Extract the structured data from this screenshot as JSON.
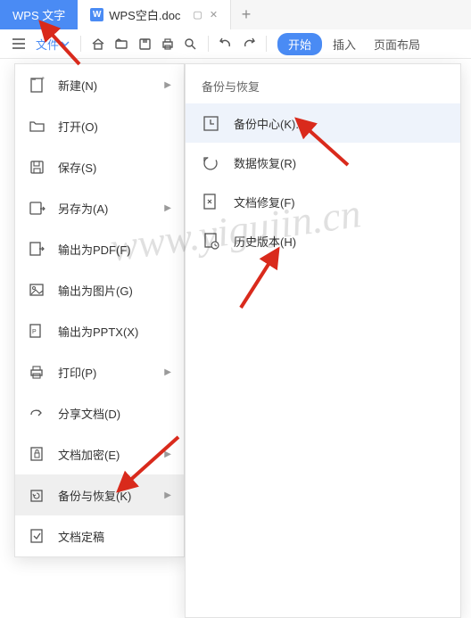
{
  "tabs": {
    "app": "WPS 文字",
    "doc": "WPS空白.doc",
    "doc_badge": "W"
  },
  "toolbar": {
    "file_label": "文件",
    "start": "开始",
    "insert": "插入",
    "pagelayout": "页面布局"
  },
  "filemenu": {
    "items": [
      {
        "label": "新建(N)",
        "arrow": true
      },
      {
        "label": "打开(O)",
        "arrow": false
      },
      {
        "label": "保存(S)",
        "arrow": false
      },
      {
        "label": "另存为(A)",
        "arrow": true
      },
      {
        "label": "输出为PDF(F)",
        "arrow": false
      },
      {
        "label": "输出为图片(G)",
        "arrow": false
      },
      {
        "label": "输出为PPTX(X)",
        "arrow": false
      },
      {
        "label": "打印(P)",
        "arrow": true
      },
      {
        "label": "分享文档(D)",
        "arrow": false
      },
      {
        "label": "文档加密(E)",
        "arrow": true
      },
      {
        "label": "备份与恢复(K)",
        "arrow": true
      },
      {
        "label": "文档定稿",
        "arrow": false
      }
    ]
  },
  "submenu": {
    "title": "备份与恢复",
    "items": [
      {
        "label": "备份中心(K)..."
      },
      {
        "label": "数据恢复(R)"
      },
      {
        "label": "文档修复(F)"
      },
      {
        "label": "历史版本(H)"
      }
    ]
  },
  "watermark": "www.yigujin.cn"
}
